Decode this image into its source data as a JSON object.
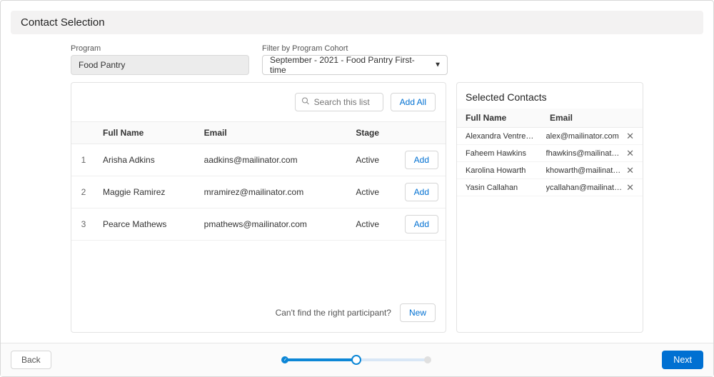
{
  "title": "Contact Selection",
  "program": {
    "label": "Program",
    "value": "Food Pantry"
  },
  "cohort": {
    "label": "Filter by Program Cohort",
    "value": "September - 2021 - Food Pantry First-time"
  },
  "search": {
    "placeholder": "Search this list"
  },
  "add_all_label": "Add All",
  "add_label": "Add",
  "table": {
    "columns": {
      "name": "Full Name",
      "email": "Email",
      "stage": "Stage"
    },
    "rows": [
      {
        "idx": "1",
        "name": "Arisha Adkins",
        "email": "aadkins@mailinator.com",
        "stage": "Active"
      },
      {
        "idx": "2",
        "name": "Maggie Ramirez",
        "email": "mramirez@mailinator.com",
        "stage": "Active"
      },
      {
        "idx": "3",
        "name": "Pearce Mathews",
        "email": "pmathews@mailinator.com",
        "stage": "Active"
      }
    ]
  },
  "footer_prompt": "Can't find the right participant?",
  "new_label": "New",
  "selected": {
    "title": "Selected Contacts",
    "columns": {
      "name": "Full Name",
      "email": "Email"
    },
    "rows": [
      {
        "name": "Alexandra Ventre…",
        "email": "alex@mailinator.com"
      },
      {
        "name": "Faheem Hawkins",
        "email": "fhawkins@mailinator.com"
      },
      {
        "name": "Karolina Howarth",
        "email": "khowarth@mailinator.c…"
      },
      {
        "name": "Yasin Callahan",
        "email": "ycallahan@mailinator.c…"
      }
    ]
  },
  "nav": {
    "back": "Back",
    "next": "Next"
  }
}
